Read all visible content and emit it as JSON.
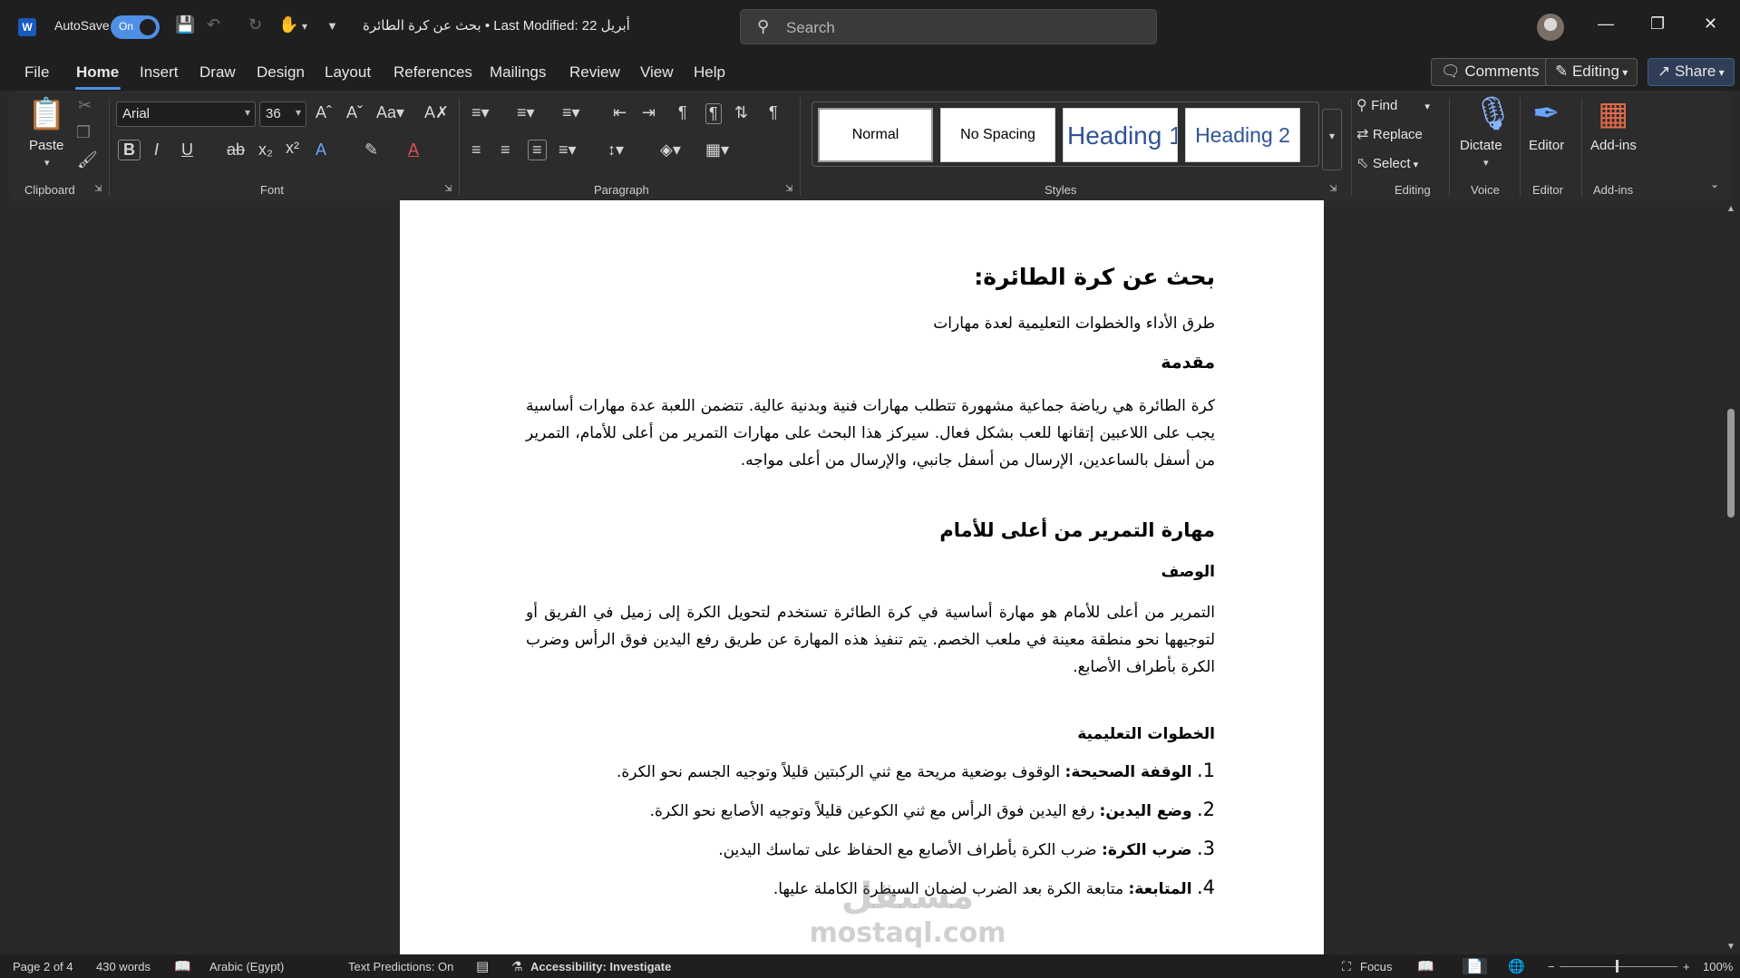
{
  "titlebar": {
    "autosave_label": "AutoSave",
    "autosave_state": "On",
    "doc_title": "بحث عن كرة الطائرة • Last Modified: 22 أبريل",
    "search_placeholder": "Search"
  },
  "menu": {
    "tabs": [
      "File",
      "Home",
      "Insert",
      "Draw",
      "Design",
      "Layout",
      "References",
      "Mailings",
      "Review",
      "View",
      "Help"
    ],
    "active": "Home",
    "comments": "Comments",
    "editing": "Editing",
    "share": "Share"
  },
  "ribbon": {
    "clipboard": {
      "paste": "Paste",
      "label": "Clipboard"
    },
    "font": {
      "family": "Arial",
      "size": "36",
      "label": "Font"
    },
    "paragraph": {
      "label": "Paragraph"
    },
    "styles": {
      "label": "Styles",
      "tiles": [
        "Normal",
        "No Spacing",
        "Heading 1",
        "Heading 2"
      ]
    },
    "editing": {
      "find": "Find",
      "replace": "Replace",
      "select": "Select",
      "label": "Editing"
    },
    "voice": {
      "dictate": "Dictate",
      "label": "Voice"
    },
    "editor": {
      "button": "Editor",
      "label": "Editor"
    },
    "addins": {
      "button": "Add-ins",
      "label": "Add-ins"
    }
  },
  "document": {
    "title": "بحث عن كرة الطائرة:",
    "subtitle": "طرق الأداء والخطوات التعليمية لعدة مهارات",
    "intro_heading": "مقدمة",
    "intro_text": "كرة الطائرة هي رياضة جماعية مشهورة تتطلب مهارات فنية وبدنية عالية. تتضمن اللعبة عدة مهارات أساسية يجب على اللاعبين إتقانها للعب بشكل فعال. سيركز هذا البحث على مهارات التمرير من أعلى للأمام، التمرير من أسفل بالساعدين، الإرسال من أسفل جانبي، والإرسال من أعلى مواجه.",
    "skill_heading": "مهارة التمرير من أعلى للأمام",
    "desc_heading": "الوصف",
    "desc_text": "التمرير من أعلى للأمام هو مهارة أساسية في كرة الطائرة تستخدم لتحويل الكرة إلى زميل في الفريق أو لتوجيهها نحو منطقة معينة في ملعب الخصم. يتم تنفيذ هذه المهارة عن طريق رفع اليدين فوق الرأس وضرب الكرة بأطراف الأصابع.",
    "steps_heading": "الخطوات التعليمية",
    "steps": [
      {
        "num": "1.",
        "label": "الوقفة الصحيحة:",
        "text": " الوقوف بوضعية مريحة مع ثني الركبتين قليلاً وتوجيه الجسم نحو الكرة."
      },
      {
        "num": "2.",
        "label": "وضع اليدين:",
        "text": " رفع اليدين فوق الرأس مع ثني الكوعين قليلاً وتوجيه الأصابع نحو الكرة."
      },
      {
        "num": "3.",
        "label": "ضرب الكرة:",
        "text": " ضرب الكرة بأطراف الأصابع مع الحفاظ على تماسك اليدين."
      },
      {
        "num": "4.",
        "label": "المتابعة:",
        "text": " متابعة الكرة بعد الضرب لضمان السيطرة الكاملة عليها."
      }
    ],
    "watermark_arabic": "مستقل",
    "watermark_latin": "mostaql.com"
  },
  "status": {
    "page": "Page 2 of 4",
    "words": "430 words",
    "language": "Arabic (Egypt)",
    "predictions": "Text Predictions: On",
    "accessibility": "Accessibility: Investigate",
    "focus": "Focus",
    "zoom": "100%"
  }
}
